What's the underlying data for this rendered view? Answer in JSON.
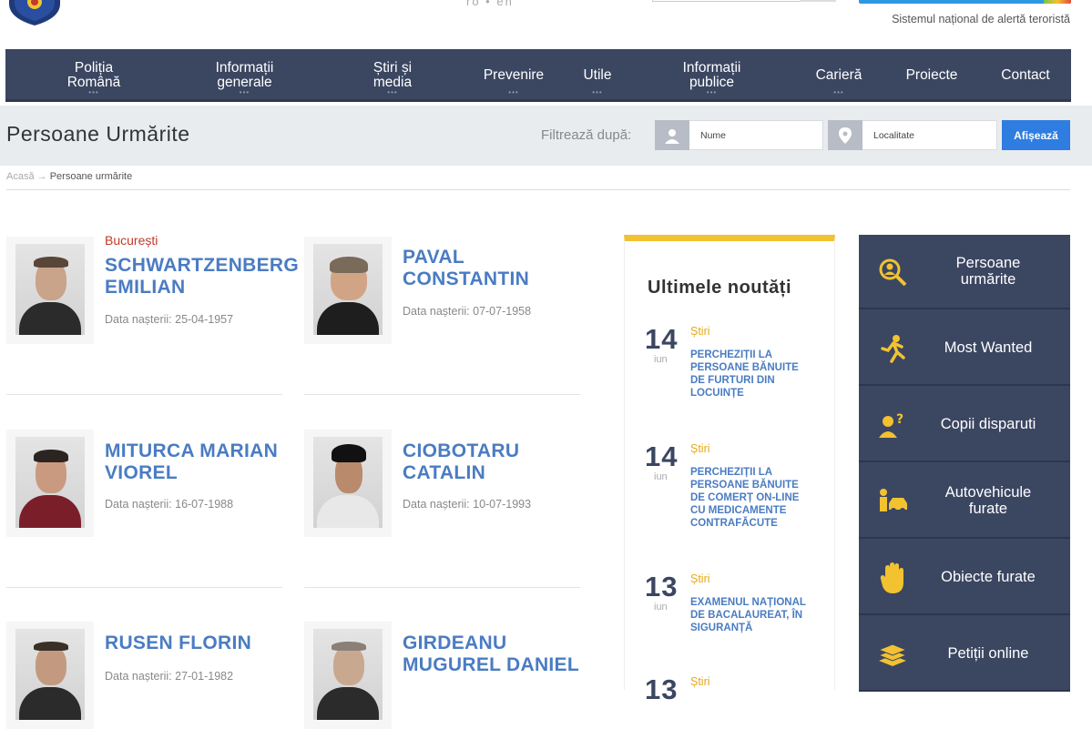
{
  "header": {
    "lang": "ro  •  en",
    "alert_text": "Sistemul național de alertă teroristă"
  },
  "nav": {
    "items": [
      {
        "label": "Poliția\nRomână"
      },
      {
        "label": "Informații\ngenerale"
      },
      {
        "label": "Știri și\nmedia"
      },
      {
        "label": "Prevenire"
      },
      {
        "label": "Utile"
      },
      {
        "label": "Informații\npublice"
      },
      {
        "label": "Carieră"
      },
      {
        "label": "Proiecte"
      },
      {
        "label": "Contact"
      }
    ]
  },
  "page": {
    "title": "Persoane Urmărite",
    "filter_label": "Filtrează după:",
    "name_placeholder": "Nume",
    "locality_placeholder": "Localitate",
    "button_label": "Afișează"
  },
  "breadcrumb": {
    "home": "Acasă",
    "sep": "→",
    "current": "Persoane urmărite"
  },
  "persons": [
    {
      "city": "București",
      "name": "SCHWARTZENBERG\nEMILIAN",
      "dob": "Data nașterii: 25-04-1957"
    },
    {
      "city": "",
      "name": "PAVAL\nCONSTANTIN",
      "dob": "Data nașterii: 07-07-1958"
    },
    {
      "city": "",
      "name": "MITURCA MARIAN\nVIOREL",
      "dob": "Data nașterii: 16-07-1988"
    },
    {
      "city": "",
      "name": "CIOBOTARU\nCATALIN",
      "dob": "Data nașterii: 10-07-1993"
    },
    {
      "city": "",
      "name": "RUSEN FLORIN",
      "dob": "Data nașterii: 27-01-1982"
    },
    {
      "city": "",
      "name": "GIRDEANU\nMUGUREL DANIEL",
      "dob": ""
    }
  ],
  "news": {
    "title": "Ultimele noutăți",
    "items": [
      {
        "day": "14",
        "month": "iun",
        "category": "Știri",
        "text": "PERCHEZIȚII LA PERSOANE BĂNUITE DE FURTURI DIN LOCUINȚE"
      },
      {
        "day": "14",
        "month": "iun",
        "category": "Știri",
        "text": "PERCHEZIȚII LA PERSOANE BĂNUITE DE COMERȚ ON-LINE CU MEDICAMENTE CONTRAFĂCUTE"
      },
      {
        "day": "13",
        "month": "iun",
        "category": "Știri",
        "text": "EXAMENUL NAȚIONAL DE BACALAUREAT, ÎN SIGURANȚĂ"
      },
      {
        "day": "13",
        "month": "",
        "category": "Știri",
        "text": ""
      }
    ]
  },
  "sidemenu": {
    "items": [
      {
        "label": "Persoane\nurmărite",
        "icon": "magnifier-person-icon"
      },
      {
        "label": "Most Wanted",
        "icon": "running-person-icon"
      },
      {
        "label": "Copii disparuti",
        "icon": "child-question-icon"
      },
      {
        "label": "Autovehicule\nfurate",
        "icon": "car-thief-icon"
      },
      {
        "label": "Obiecte furate",
        "icon": "hand-icon"
      },
      {
        "label": "Petiții online",
        "icon": "documents-stack-icon"
      }
    ]
  }
}
